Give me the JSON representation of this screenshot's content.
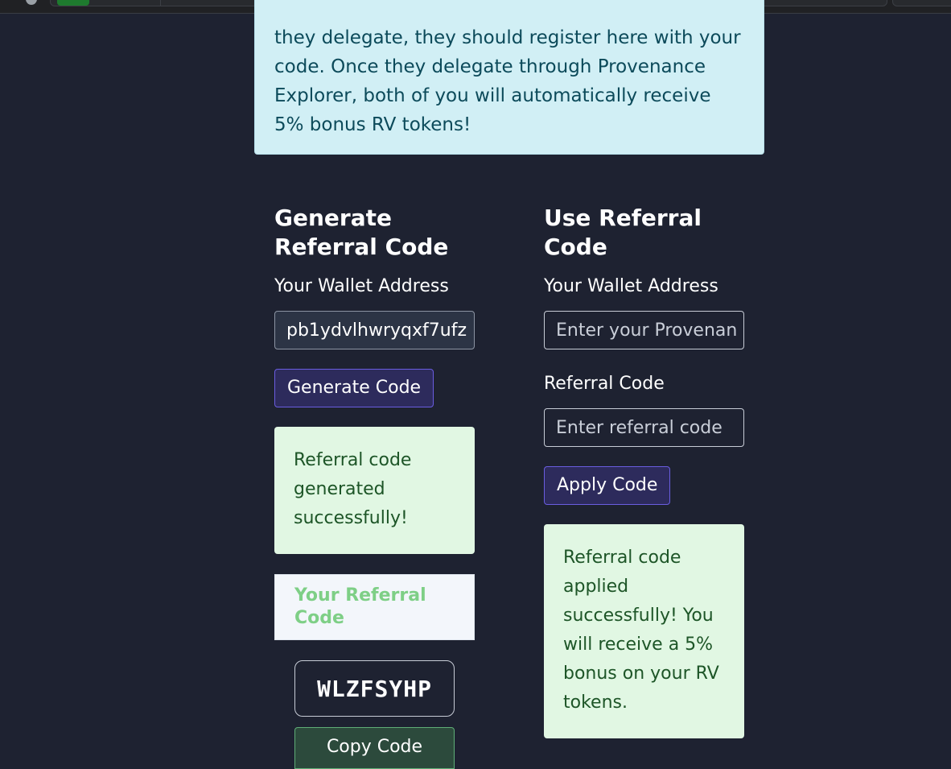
{
  "info": {
    "text": "they delegate, they should register here with your code. Once they delegate through Provenance Explorer, both of you will automatically receive 5% bonus RV tokens!"
  },
  "generate": {
    "title": "Generate Referral Code",
    "wallet_label": "Your Wallet Address",
    "wallet_value": "pb1ydvlhwryqxf7ufz",
    "button": "Generate Code",
    "success": "Referral code generated successfully!",
    "card_title": "Your Referral Code",
    "code": "WLZFSYHP",
    "copy_button": "Copy Code"
  },
  "use": {
    "title": "Use Referral Code",
    "wallet_label": "Your Wallet Address",
    "wallet_placeholder": "Enter your Provenan",
    "code_label": "Referral Code",
    "code_placeholder": "Enter referral code",
    "button": "Apply Code",
    "success": "Referral code applied successfully! You will receive a 5% bonus on your RV tokens."
  },
  "colors": {
    "background": "#1e2231",
    "info_bg": "#d1eff5",
    "success_bg": "#e1f7e3",
    "button_bg": "#2d2b5c",
    "copy_button_bg": "#2c4a3c",
    "card_title": "#7ecf86"
  }
}
